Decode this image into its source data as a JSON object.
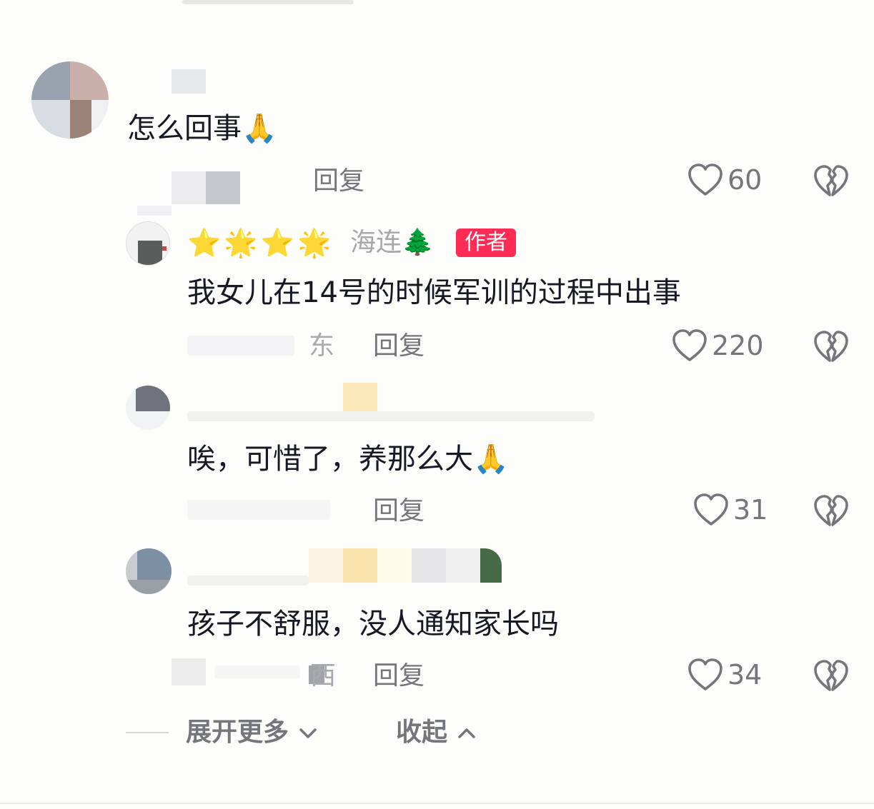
{
  "comments": [
    {
      "text": "怎么回事",
      "emoji": "🙏",
      "reply_label": "回复",
      "like_count": "60"
    }
  ],
  "replies": [
    {
      "stars": [
        "⭐",
        "🌟",
        "⭐",
        "🌟"
      ],
      "name": "海连",
      "tree": "🌲",
      "badge": "作者",
      "text": "我女儿在14号的时候军训的过程中出事",
      "location": "东",
      "reply_label": "回复",
      "like_count": "220"
    },
    {
      "text": "唉，可惜了，养那么大",
      "emoji": "🙏",
      "reply_label": "回复",
      "like_count": "31"
    },
    {
      "text": "孩子不舒服，没人通知家长吗",
      "location": "西",
      "reply_label": "回复",
      "like_count": "34"
    }
  ],
  "footer": {
    "expand_label": "展开更多",
    "collapse_label": "收起"
  },
  "icons": {
    "like": "heart-outline-icon",
    "dislike": "broken-heart-icon",
    "expand": "chevron-down-icon",
    "collapse": "chevron-up-icon"
  },
  "colors": {
    "text": "#161823",
    "muted": "#75767c",
    "badge": "#fe2c55",
    "background": "#fdfdfb"
  }
}
